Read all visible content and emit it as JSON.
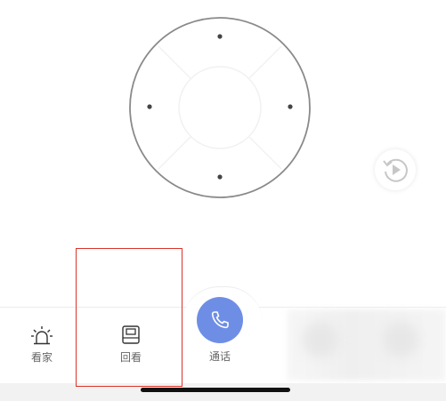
{
  "ptz_control": {
    "directions": [
      "up",
      "down",
      "left",
      "right"
    ],
    "ring_color": "#8a8a8a",
    "dot_color": "#444444"
  },
  "side_button": {
    "icon": "replay-icon"
  },
  "tabbar": {
    "tabs": [
      {
        "id": "watch",
        "label": "看家",
        "icon": "alarm-light-icon"
      },
      {
        "id": "replay",
        "label": "回看",
        "icon": "playback-icon"
      },
      {
        "id": "call",
        "label": "通话",
        "icon": "phone-icon"
      }
    ]
  },
  "colors": {
    "accent": "#6e8ee6",
    "highlight": "#d9342b",
    "label": "#666666"
  }
}
